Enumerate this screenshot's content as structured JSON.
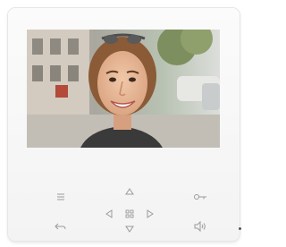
{
  "device": {
    "screen": {
      "content": "video-feed-smiling-woman-street"
    },
    "buttons": [
      {
        "name": "menu-button",
        "icon": "menu-icon"
      },
      {
        "name": "key-unlock-button",
        "icon": "key-icon"
      },
      {
        "name": "nav-up-button",
        "icon": "triangle-up-icon"
      },
      {
        "name": "nav-left-button",
        "icon": "triangle-left-icon"
      },
      {
        "name": "nav-center-button",
        "icon": "grid-icon"
      },
      {
        "name": "nav-right-button",
        "icon": "triangle-right-icon"
      },
      {
        "name": "nav-down-button",
        "icon": "triangle-down-icon"
      },
      {
        "name": "back-button",
        "icon": "return-arrow-icon"
      },
      {
        "name": "speaker-button",
        "icon": "speaker-icon"
      }
    ],
    "colors": {
      "bezel": "#f5f5f5",
      "icon": "#9a9a9a"
    }
  }
}
